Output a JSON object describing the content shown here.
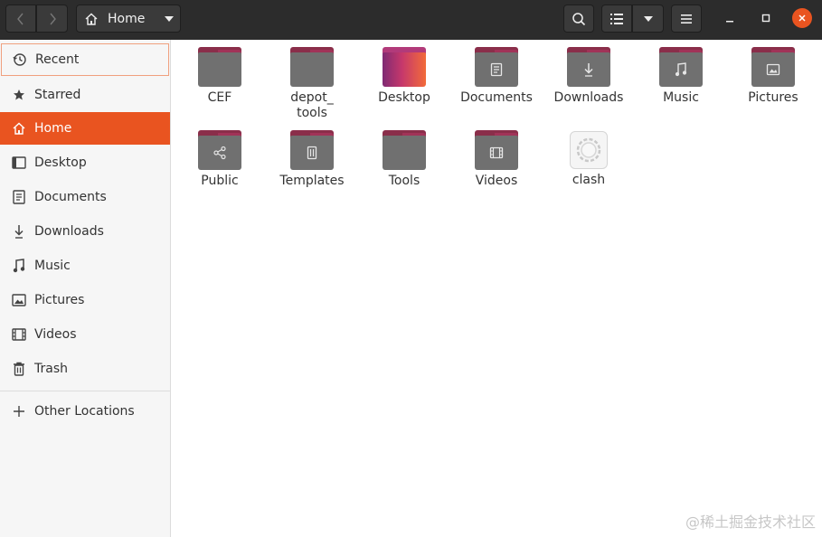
{
  "header": {
    "path_label": "Home",
    "icons": {
      "back": "chevron-left-icon",
      "forward": "chevron-right-icon",
      "home": "home-icon",
      "search": "search-icon",
      "list_view": "list-view-icon",
      "view_options": "chevron-down-icon",
      "menu": "hamburger-menu-icon",
      "minimize": "minimize-icon",
      "maximize": "maximize-icon",
      "close": "close-icon"
    },
    "close_color": "#e95420"
  },
  "sidebar": {
    "items": [
      {
        "label": "Recent",
        "icon": "clock-icon"
      },
      {
        "label": "Starred",
        "icon": "star-icon"
      },
      {
        "label": "Home",
        "icon": "home-icon",
        "active": true
      },
      {
        "label": "Desktop",
        "icon": "desktop-icon"
      },
      {
        "label": "Documents",
        "icon": "document-icon"
      },
      {
        "label": "Downloads",
        "icon": "download-icon"
      },
      {
        "label": "Music",
        "icon": "music-icon"
      },
      {
        "label": "Pictures",
        "icon": "picture-icon"
      },
      {
        "label": "Videos",
        "icon": "video-icon"
      },
      {
        "label": "Trash",
        "icon": "trash-icon"
      },
      {
        "label": "Other Locations",
        "icon": "plus-icon"
      }
    ],
    "accent": "#e95420"
  },
  "files": [
    {
      "label": "CEF",
      "type": "folder"
    },
    {
      "label": "depot_ tools",
      "type": "folder"
    },
    {
      "label": "Desktop",
      "type": "desktop-folder"
    },
    {
      "label": "Documents",
      "type": "folder",
      "emblem": "document-icon"
    },
    {
      "label": "Downloads",
      "type": "folder",
      "emblem": "download-icon"
    },
    {
      "label": "Music",
      "type": "folder",
      "emblem": "music-icon"
    },
    {
      "label": "Pictures",
      "type": "folder",
      "emblem": "picture-icon"
    },
    {
      "label": "Public",
      "type": "folder",
      "emblem": "share-icon"
    },
    {
      "label": "Templates",
      "type": "folder",
      "emblem": "template-icon"
    },
    {
      "label": "Tools",
      "type": "folder"
    },
    {
      "label": "Videos",
      "type": "folder",
      "emblem": "video-icon"
    },
    {
      "label": "clash",
      "type": "application",
      "icon": "gear-icon"
    }
  ],
  "watermark": "@稀土掘金技术社区"
}
